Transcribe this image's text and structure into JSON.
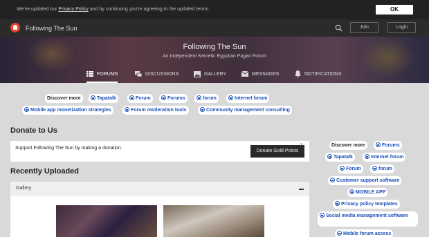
{
  "cookie": {
    "text_before": "We've updated our ",
    "link": "Privacy Policy",
    "text_after": " and by continuing you're agreeing to the updated terms.",
    "ok_label": "OK"
  },
  "topnav": {
    "site_name": "Following The Sun",
    "join_label": "Join",
    "login_label": "Login"
  },
  "banner": {
    "title": "Following The Sun",
    "subtitle": "An Independent Kemetic Egyptian Pagan Forum"
  },
  "tabs": [
    {
      "label": "FORUMS",
      "icon": "list-icon"
    },
    {
      "label": "DISCUSSIONS",
      "icon": "chat-icon"
    },
    {
      "label": "GALLERY",
      "icon": "image-icon"
    },
    {
      "label": "MESSAGES",
      "icon": "envelope-icon"
    },
    {
      "label": "NOTIFICATIONS",
      "icon": "bell-icon"
    }
  ],
  "top_tags": {
    "head": "Discover more",
    "items": [
      "Tapatalk",
      "Forum",
      "Forums",
      "forum",
      "Internet forum",
      "Mobile app monetization strategies",
      "Forum moderation tools",
      "Community management consulting"
    ]
  },
  "donate": {
    "title": "Donate to Us",
    "text": "Support Following The Sun by making a donation.",
    "button": "Donate Gold Points",
    "close": "x"
  },
  "recent": {
    "title": "Recently Uploaded",
    "gallery_label": "Gallery"
  },
  "side_tags": {
    "head": "Discover more",
    "items": [
      "Forums",
      "Tapatalk",
      "Internet forum",
      "Forum",
      "forum",
      "Customer support software",
      "MOBILE APP",
      "Privacy policy templates",
      "Social media management software",
      "Mobile forum access"
    ]
  },
  "colors": {
    "link_blue": "#1a4fb8",
    "topbar": "#222222",
    "page_bg": "#d9d9d9"
  }
}
